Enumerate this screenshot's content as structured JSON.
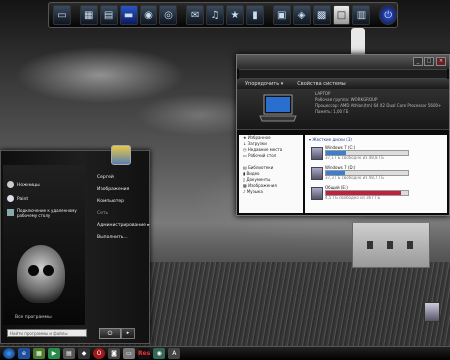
{
  "explorer": {
    "toolbar": {
      "organize": "Упорядочить ▾",
      "system_properties": "Свойства системы"
    },
    "computer_name": "LAPTOP",
    "computer_info": [
      "Рабочая группа: WORKGROUP",
      "Процессор: AMD Athlon(tm) 64 X2 Dual Core Processor 5600+",
      "Память: 1,00 ГБ"
    ],
    "nav": [
      {
        "label": "Избранное",
        "icon": "star-icon"
      },
      {
        "label": "Загрузки",
        "icon": "download-icon"
      },
      {
        "label": "Недавние места",
        "icon": "clock-icon"
      },
      {
        "label": "Рабочий стол",
        "icon": "desktop-icon"
      },
      {
        "label": "",
        "icon": ""
      },
      {
        "label": "Библиотеки",
        "icon": "library-icon"
      },
      {
        "label": "Видео",
        "icon": "video-icon"
      },
      {
        "label": "Документы",
        "icon": "documents-icon"
      },
      {
        "label": "Изображения",
        "icon": "pictures-icon"
      },
      {
        "label": "Музыка",
        "icon": "music-icon"
      }
    ],
    "section_title": "▾ Жесткие диски (3)",
    "drives": [
      {
        "name": "Windows 7 (C:)",
        "free": "37,1 ГБ свободно из 48,8 ГБ",
        "used_fraction": 0.24,
        "bar_color": "#3b7fd1"
      },
      {
        "name": "Windows 7 (D:)",
        "free": "37,3 ГБ свободно из 48,7 ГБ",
        "used_fraction": 0.23,
        "bar_color": "#3b7fd1"
      },
      {
        "name": "Общий (E:)",
        "free": "4,5 ГБ свободно из 367 ГБ",
        "used_fraction": 0.92,
        "bar_color": "#c0223b"
      }
    ]
  },
  "startmenu": {
    "pinned": [
      {
        "label": "Ножницы"
      },
      {
        "label": "Paint"
      },
      {
        "label": "Подключение к удаленному рабочему столу"
      }
    ],
    "right_items": [
      {
        "label": "Сергей"
      },
      {
        "label": "Изображения"
      },
      {
        "label": "Компьютер"
      },
      {
        "label": "Сеть"
      },
      {
        "label": "Администрирование ▸"
      },
      {
        "label": "Выполнить..."
      }
    ],
    "all_programs": "Все программы",
    "search_placeholder": "Найти программы и файлы",
    "shutdown_icon": "power-icon"
  },
  "taskbar": {
    "items": [
      "start-orb-icon",
      "ie-icon",
      "calendar-icon",
      "media-icon",
      "explorer-icon",
      "app-icon",
      "opera-icon",
      "camera-icon",
      "folder-icon",
      "res-icon",
      "utility-icon",
      "text-icon"
    ],
    "res_label": "Res"
  },
  "dock": {
    "items": [
      "computer-icon",
      "gadget-icon",
      "folder-icon",
      "monitor-icon",
      "globe-icon",
      "network-icon",
      "control-icon",
      "music-icon",
      "star-icon",
      "video-icon",
      "window-icon",
      "game-icon",
      "image-icon",
      "note-icon",
      "archive-icon",
      "power-icon"
    ]
  }
}
